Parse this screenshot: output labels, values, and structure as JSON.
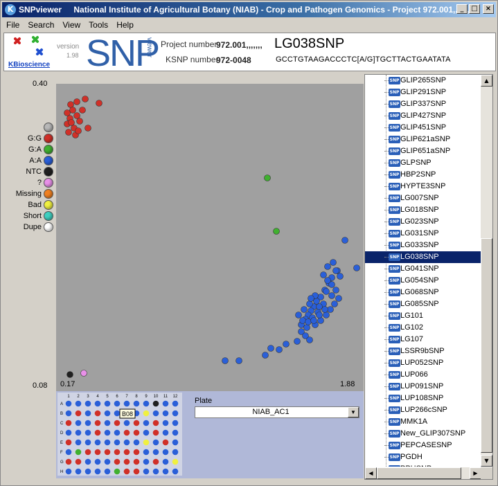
{
  "window": {
    "app_name": "SNPviewer",
    "title": "National Institute of Agricultural Botany (NIAB) - Crop and Pathogen Genomics - Project 972.001,,,,,,,",
    "min_icon": "minimize-icon",
    "max_icon": "maximize-icon",
    "close_icon": "close-icon"
  },
  "menu": [
    "File",
    "Search",
    "View",
    "Tools",
    "Help"
  ],
  "header": {
    "company": "KBioscience",
    "version_label": "version",
    "version": "1.98",
    "logo_big": "SNP",
    "logo_small": "viewer",
    "project_label": "Project number",
    "project_value": "972.001,,,,,,,",
    "ksnp_label": "KSNP number",
    "ksnp_value": "972-0048",
    "snp_name": "LG038SNP",
    "sequence": "GCCTGTAAGACCCTC[A/G]TGCTTACTGAATATA"
  },
  "plot": {
    "y_max": "0.40",
    "y_min": "0.08",
    "x_min": "0.17",
    "x_max": "1.88"
  },
  "legend": [
    {
      "label": "",
      "color": "#b8b8b8"
    },
    {
      "label": "G:G",
      "color": "#d03028"
    },
    {
      "label": "G:A",
      "color": "#40b030"
    },
    {
      "label": "A:A",
      "color": "#2a5fd8"
    },
    {
      "label": "NTC",
      "color": "#202020"
    },
    {
      "label": "?",
      "color": "#e890e8"
    },
    {
      "label": "Missing",
      "color": "#f08020"
    },
    {
      "label": "Bad",
      "color": "#f0f040"
    },
    {
      "label": "Short",
      "color": "#40d0c0"
    },
    {
      "label": "Dupe",
      "color": "#ffffff"
    }
  ],
  "plate": {
    "label": "Plate",
    "selected": "NIAB_AC1",
    "dropdown_icon": "chevron-down-icon",
    "cols": [
      "1",
      "2",
      "3",
      "4",
      "5",
      "6",
      "7",
      "8",
      "9",
      "10",
      "11",
      "12"
    ],
    "rows": [
      "A",
      "B",
      "C",
      "D",
      "E",
      "F",
      "G",
      "H"
    ],
    "highlight_well": "B08",
    "wells": [
      "BBBBBBBBBKBB",
      "BRBRBBBHYBBB",
      "RBBRBRBRBRBB",
      "BBBRBBRRBRBB",
      "RBBBBBBBYBRB",
      "BGRRRRRRBBBB",
      "RRBBBRRRBRBY",
      "BBBBBGRRBBBB"
    ],
    "well_colors": {
      "B": "#2a5fd8",
      "R": "#d03028",
      "G": "#40b030",
      "Y": "#f0f040",
      "K": "#202020",
      "H": "#2a5fd8"
    }
  },
  "snp_list": {
    "items": [
      "GLIP265SNP",
      "GLIP291SNP",
      "GLIP337SNP",
      "GLIP427SNP",
      "GLIP451SNP",
      "GLIP621aSNP",
      "GLIP651aSNP",
      "GLPSNP",
      "HBP2SNP",
      "HYPTE3SNP",
      "LG007SNP",
      "LG018SNP",
      "LG023SNP",
      "LG031SNP",
      "LG033SNP",
      "LG038SNP",
      "LG041SNP",
      "LG054SNP",
      "LG068SNP",
      "LG085SNP",
      "LG101",
      "LG102",
      "LG107",
      "LSSR9bSNP",
      "LUP052SNP",
      "LUP066",
      "LUP091SNP",
      "LUP108SNP",
      "LUP266cSNP",
      "MMK1A",
      "New_GLIP307SNP",
      "PEPCASESNP",
      "PGDH",
      "PPHSNP"
    ],
    "selected": "LG038SNP",
    "icon_text": "SNP",
    "scroll_up_icon": "scroll-up-icon",
    "scroll_down_icon": "scroll-down-icon",
    "scroll_left_icon": "scroll-left-icon",
    "scroll_right_icon": "scroll-right-icon"
  }
}
